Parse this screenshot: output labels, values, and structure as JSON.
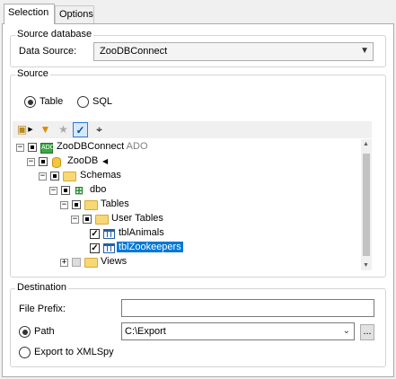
{
  "tabs": {
    "selection": "Selection",
    "options": "Options"
  },
  "source_database": {
    "title": "Source database",
    "data_source_label": "Data Source:",
    "data_source_value": "ZooDBConnect"
  },
  "source": {
    "title": "Source",
    "table_label": "Table",
    "sql_label": "SQL",
    "selected_mode": "Table"
  },
  "tree": {
    "connection": {
      "label": "ZooDBConnect",
      "suffix": "ADO"
    },
    "database": "ZooDB",
    "schemas": "Schemas",
    "schema": "dbo",
    "tables": "Tables",
    "user_tables": "User Tables",
    "tables_list": [
      {
        "label": "tblAnimals",
        "checked": true
      },
      {
        "label": "tblZookeepers",
        "checked": true,
        "selected": true
      }
    ],
    "views": "Views"
  },
  "destination": {
    "title": "Destination",
    "file_prefix_label": "File Prefix:",
    "file_prefix_value": "",
    "path_label": "Path",
    "path_value": "C:\\Export",
    "browse_label": "...",
    "export_label": "Export to XMLSpy",
    "selected_option": "Path"
  }
}
